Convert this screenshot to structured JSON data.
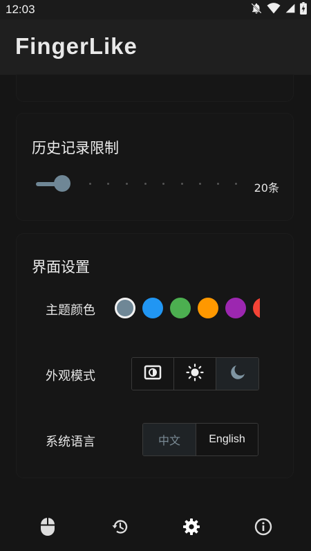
{
  "status_bar": {
    "time": "12:03",
    "icons": [
      "notifications-off-icon",
      "wifi-icon",
      "cellular-signal-icon",
      "battery-icon"
    ]
  },
  "app": {
    "title": "FingerLike"
  },
  "history_limit": {
    "title": "历史记录限制",
    "value_label": "20条",
    "slider_level": 0.0,
    "accent": "#6f8796"
  },
  "ui_settings": {
    "title": "界面设置",
    "theme_color": {
      "label": "主题颜色",
      "colors": [
        "#6f8796",
        "#2196f3",
        "#4caf50",
        "#ff9800",
        "#9c27b0",
        "#f44336"
      ],
      "selected_index": 0
    },
    "appearance_mode": {
      "label": "外观模式",
      "options": [
        "auto-brightness-icon",
        "sun-icon",
        "moon-icon"
      ],
      "selected_index": 2
    },
    "system_language": {
      "label": "系统语言",
      "options": [
        "中文",
        "English"
      ],
      "selected_index": 0
    }
  },
  "bottom_nav": {
    "items": [
      "mouse-icon",
      "history-icon",
      "settings-icon",
      "info-icon"
    ],
    "selected_index": 2
  }
}
